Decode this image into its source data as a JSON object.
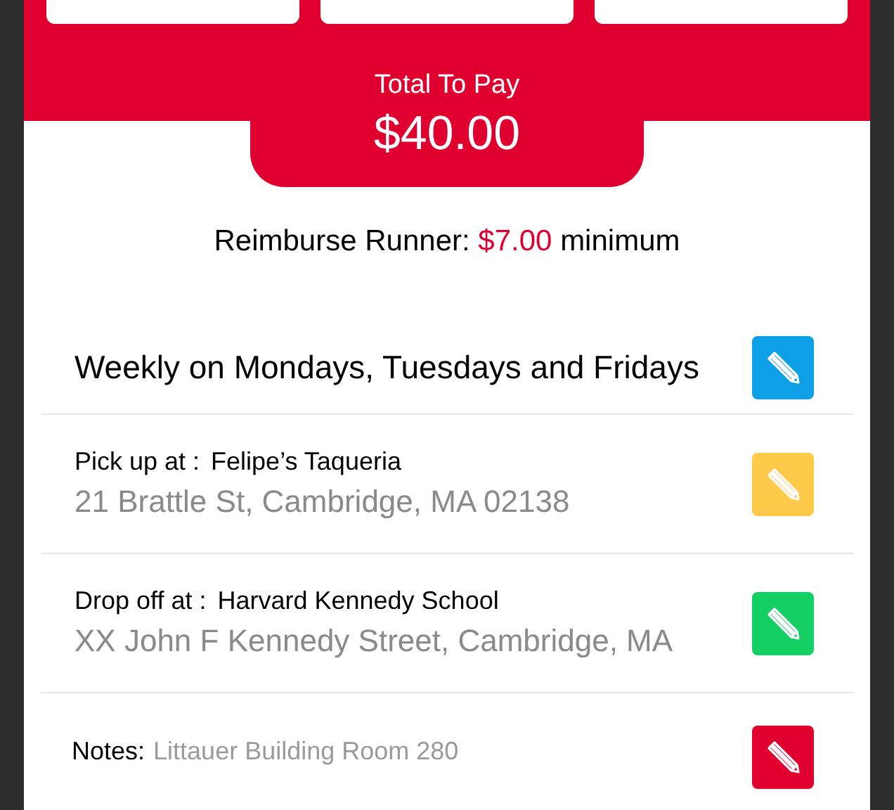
{
  "total": {
    "label": "Total To Pay",
    "amount": "$40.00"
  },
  "reimburse": {
    "prefix": "Reimburse Runner:",
    "amount": "$7.00",
    "suffix": "minimum"
  },
  "rows": [
    {
      "kind": "schedule",
      "text": "Weekly on Mondays, Tuesdays and Fridays",
      "color": "#0ea0e6"
    },
    {
      "kind": "location",
      "label": "Pick up at :",
      "place": "Felipe’s Taqueria",
      "address": "21 Brattle St, Cambridge, MA 02138",
      "color": "#ffc94a"
    },
    {
      "kind": "location",
      "label": "Drop off at :",
      "place": "Harvard Kennedy School",
      "address": "XX John F Kennedy Street, Cambridge, MA",
      "color": "#14cf64"
    },
    {
      "kind": "notes",
      "label": "Notes:",
      "text": "Littauer Building Room 280",
      "color": "#e0002f"
    }
  ]
}
